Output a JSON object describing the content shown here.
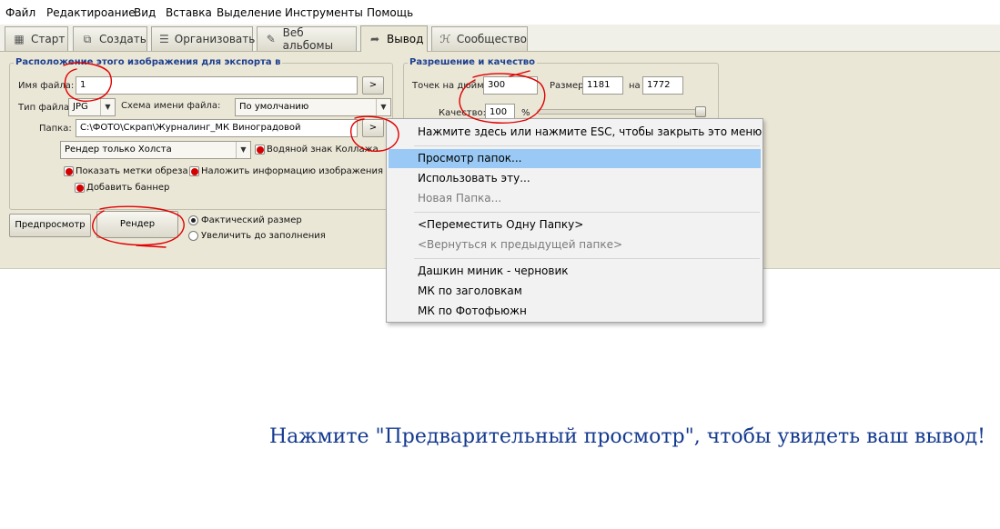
{
  "menubar": {
    "items": [
      "Файл",
      "Редактироание",
      "Вид",
      "Вставка",
      "Выделение",
      "Инструменты",
      "Помощь"
    ]
  },
  "tabs": [
    {
      "label": "Старт",
      "icon": "grid-icon"
    },
    {
      "label": "Создать",
      "icon": "create-icon"
    },
    {
      "label": "Организовать",
      "icon": "list-icon"
    },
    {
      "label": "Веб альбомы",
      "icon": "web-album-icon"
    },
    {
      "label": "Вывод",
      "icon": "export-arrow-icon",
      "active": true
    },
    {
      "label": "Сообщество",
      "icon": "community-icon"
    }
  ],
  "export": {
    "group_title": "Расположение этого изображения для экспорта в",
    "filename_label": "Имя файла:",
    "filename_value": "1",
    "filetype_label": "Тип файла:",
    "filetype_value": "JPG",
    "scheme_label": "Схема имени файла:",
    "scheme_value": "По умолчанию",
    "folder_label": "Папка:",
    "folder_value": "C:\\ФОТО\\Скрап\\Журналинг_МК Виноградовой",
    "browse_label": ">",
    "render_mode_value": "Рендер только Холста",
    "watermark_label": "Водяной знак Коллажа",
    "crop_marks_label": "Показать метки обреза",
    "image_info_label": "Наложить информацию изображения",
    "banner_label": "Добавить баннер",
    "preview_button": "Предпросмотр",
    "render_button": "Рендер",
    "actual_size_label": "Фактический размер",
    "fill_label": "Увеличить до заполнения"
  },
  "resolution": {
    "group_title": "Разрешение и качество",
    "dpi_label": "Точек на дюйм:",
    "dpi_value": "300",
    "size_label": "Размер:",
    "width_value": "1181",
    "by_label": "на",
    "height_value": "1772",
    "quality_label": "Качество:",
    "quality_value": "100",
    "quality_unit": "%",
    "quality_level": 1.0
  },
  "context_menu": {
    "header": "Нажмите здесь или нажмите ESC, чтобы закрыть это меню",
    "browse": "Просмотр папок...",
    "use_this": "Использовать эту...",
    "new_folder": "Новая Папка...",
    "move_up": "<Переместить Одну Папку>",
    "go_back": "<Вернуться к предыдущей папке>",
    "recent": [
      "Дашкин миник - черновик",
      "МК по заголовкам",
      "МК по Фотофьюжн"
    ]
  },
  "hint": "Нажмите \"Предварительный просмотр\", чтобы увидеть ваш вывод!",
  "colors": {
    "accent": "#1c3f8f",
    "highlight": "#99c9f4",
    "annotation": "#e00000",
    "panel": "#ebe7d7"
  }
}
